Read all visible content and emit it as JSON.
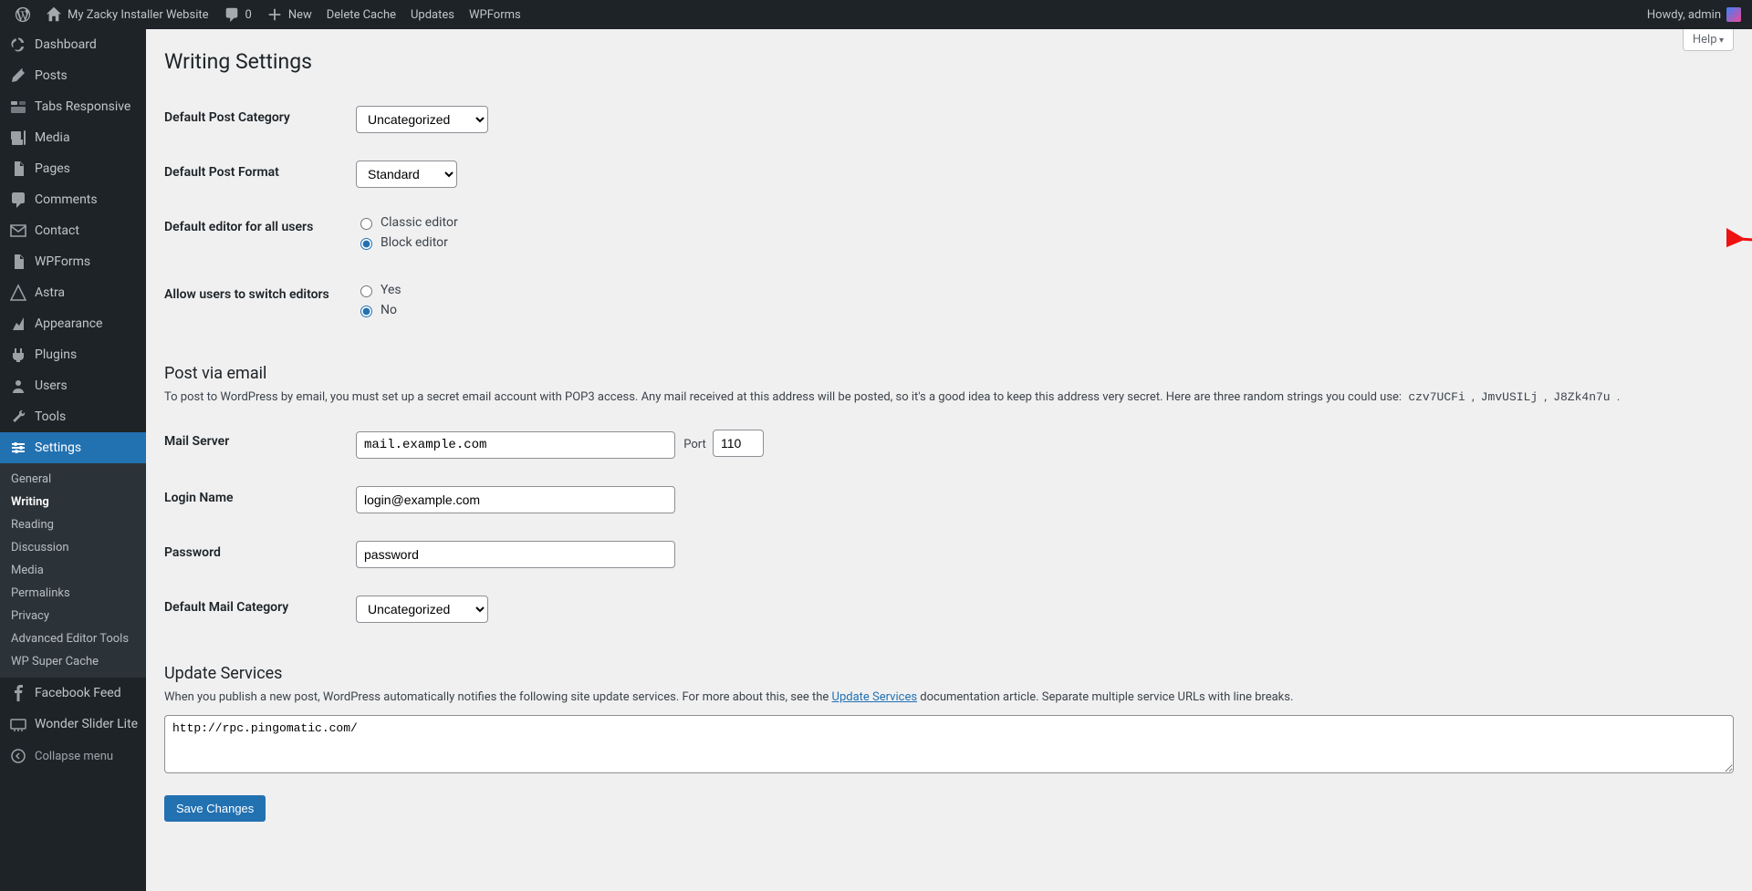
{
  "adminbar": {
    "site_name": "My Zacky Installer Website",
    "comments_count": "0",
    "new_label": "New",
    "items": [
      "Delete Cache",
      "Updates",
      "WPForms"
    ],
    "howdy": "Howdy, admin"
  },
  "sidebar": {
    "items": [
      {
        "icon": "dashboard",
        "label": "Dashboard"
      },
      {
        "icon": "pin",
        "label": "Posts"
      },
      {
        "icon": "tabs",
        "label": "Tabs Responsive"
      },
      {
        "icon": "media",
        "label": "Media"
      },
      {
        "icon": "page",
        "label": "Pages"
      },
      {
        "icon": "comments",
        "label": "Comments"
      },
      {
        "icon": "mail",
        "label": "Contact"
      },
      {
        "icon": "page",
        "label": "WPForms"
      },
      {
        "icon": "astra",
        "label": "Astra"
      },
      {
        "icon": "appearance",
        "label": "Appearance"
      },
      {
        "icon": "plugins",
        "label": "Plugins"
      },
      {
        "icon": "users",
        "label": "Users"
      },
      {
        "icon": "tools",
        "label": "Tools"
      },
      {
        "icon": "settings",
        "label": "Settings",
        "current": true
      }
    ],
    "submenu": [
      "General",
      "Writing",
      "Reading",
      "Discussion",
      "Media",
      "Permalinks",
      "Privacy",
      "Advanced Editor Tools",
      "WP Super Cache"
    ],
    "submenu_current": "Writing",
    "extra": [
      {
        "icon": "fb",
        "label": "Facebook Feed"
      },
      {
        "icon": "slider",
        "label": "Wonder Slider Lite"
      }
    ],
    "collapse": "Collapse menu"
  },
  "page": {
    "help": "Help",
    "title": "Writing Settings",
    "labels": {
      "default_category": "Default Post Category",
      "default_format": "Default Post Format",
      "default_editor": "Default editor for all users",
      "allow_switch": "Allow users to switch editors",
      "mail_server": "Mail Server",
      "port": "Port",
      "login_name": "Login Name",
      "password": "Password",
      "default_mail_category": "Default Mail Category"
    },
    "values": {
      "default_category": "Uncategorized",
      "default_format": "Standard",
      "editor_classic": "Classic editor",
      "editor_block": "Block editor",
      "switch_yes": "Yes",
      "switch_no": "No",
      "mail_server": "mail.example.com",
      "port": "110",
      "login_name": "login@example.com",
      "password": "password",
      "default_mail_category": "Uncategorized",
      "ping_services": "http://rpc.pingomatic.com/"
    },
    "sections": {
      "post_via_email": "Post via email",
      "post_via_email_desc_a": "To post to WordPress by email, you must set up a secret email account with POP3 access. Any mail received at this address will be posted, so it's a good idea to keep this address very secret. Here are three random strings you could use: ",
      "random1": "czv7UCFi",
      "random2": "JmvUSILj",
      "random3": "J8Zk4n7u",
      "update_services": "Update Services",
      "update_services_desc_a": "When you publish a new post, WordPress automatically notifies the following site update services. For more about this, see the ",
      "update_services_link": "Update Services",
      "update_services_desc_b": " documentation article. Separate multiple service URLs with line breaks."
    },
    "save": "Save Changes"
  }
}
